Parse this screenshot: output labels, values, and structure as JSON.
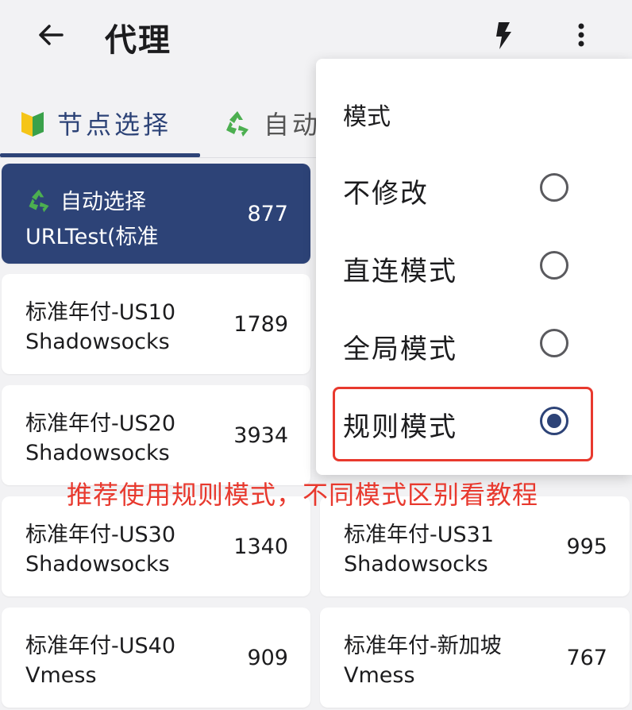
{
  "appbar": {
    "title": "代理",
    "back_icon": "arrow-left-icon",
    "bolt_icon": "lightning-icon",
    "more_icon": "more-vert-icon"
  },
  "tabs": [
    {
      "label": "节点选择",
      "icon": "beginner-shield-icon",
      "selected": true
    },
    {
      "label": "自动",
      "icon": "recycle-icon",
      "selected": false
    }
  ],
  "proxies": {
    "selected": {
      "icon": "recycle-icon",
      "name": "自动选择",
      "type": "URLTest(标准",
      "latency": "877"
    },
    "left": [
      {
        "name": "标准年付-US10",
        "type": "Shadowsocks",
        "latency": "1789"
      },
      {
        "name": "标准年付-US20",
        "type": "Shadowsocks",
        "latency": "3934"
      },
      {
        "name": "标准年付-US30",
        "type": "Shadowsocks",
        "latency": "1340"
      },
      {
        "name": "标准年付-US40",
        "type": "Vmess",
        "latency": "909"
      }
    ],
    "right": [
      {
        "name": "标准年付-US31",
        "type": "Shadowsocks",
        "latency": "995"
      },
      {
        "name": "标准年付-新加坡",
        "type": "Vmess",
        "latency": "767"
      }
    ]
  },
  "menu": {
    "header": "模式",
    "items": [
      {
        "label": "不修改",
        "selected": false
      },
      {
        "label": "直连模式",
        "selected": false
      },
      {
        "label": "全局模式",
        "selected": false
      },
      {
        "label": "规则模式",
        "selected": true
      }
    ]
  },
  "annotation": "推荐使用规则模式，不同模式区别看教程",
  "colors": {
    "accent": "#2d4377",
    "annotation": "#e8392e",
    "background": "#f2f2f4"
  }
}
